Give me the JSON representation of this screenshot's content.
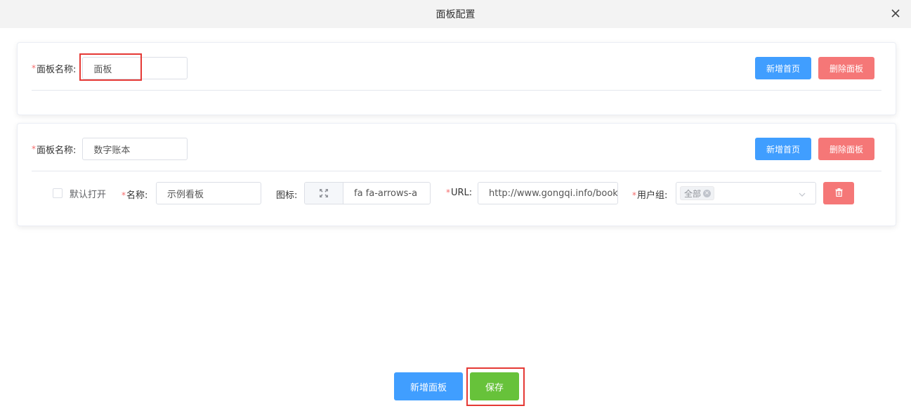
{
  "dialog": {
    "title": "面板配置",
    "close_icon": "close-icon"
  },
  "panels": [
    {
      "name_label": "面板名称:",
      "name_value": "面板",
      "add_home_label": "新增首页",
      "delete_panel_label": "删除面板"
    },
    {
      "name_label": "面板名称:",
      "name_value": "数字账本",
      "add_home_label": "新增首页",
      "delete_panel_label": "删除面板",
      "items": [
        {
          "default_open_label": "默认打开",
          "default_open_checked": false,
          "name_label": "名称:",
          "name_value": "示例看板",
          "icon_label": "图标:",
          "icon_preview": "arrows-alt-icon",
          "icon_value": "fa fa-arrows-a",
          "url_label": "URL:",
          "url_value": "http://www.gongqi.info/book/C",
          "group_label": "用户组:",
          "group_tag": "全部",
          "delete_icon": "trash-icon"
        }
      ]
    }
  ],
  "footer": {
    "add_panel_label": "新增面板",
    "save_label": "保存"
  },
  "colors": {
    "primary": "#409eff",
    "danger": "#f56c6c",
    "success": "#67c23a",
    "required": "#f56c6c",
    "highlight": "#e53935"
  }
}
